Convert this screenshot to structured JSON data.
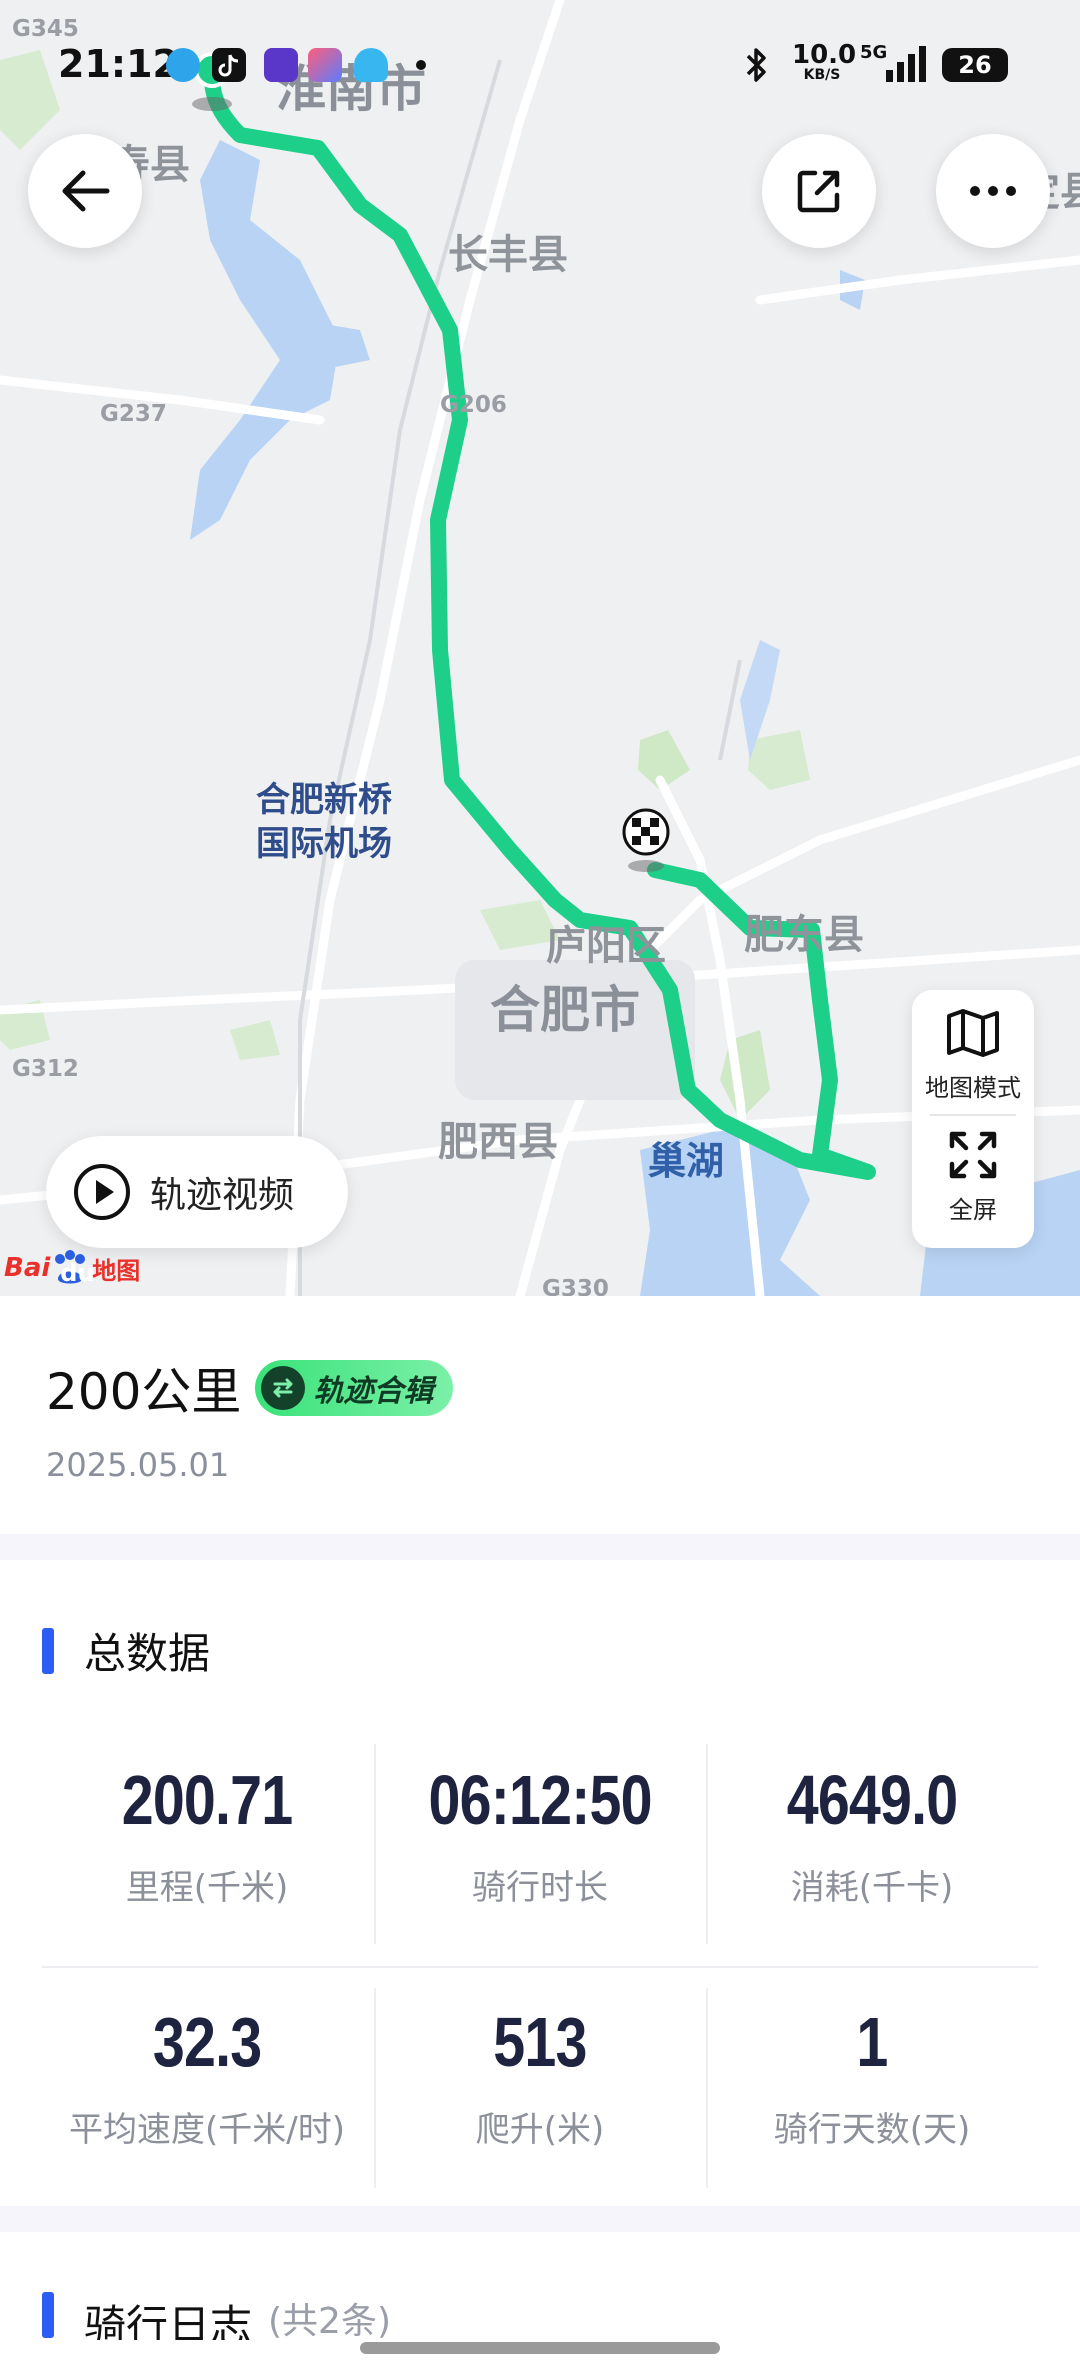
{
  "status_bar": {
    "time": "21:12",
    "net_speed_value": "10.0",
    "net_speed_unit": "KB/S",
    "network": "5G",
    "battery": "26"
  },
  "map": {
    "labels": {
      "huainan": "淮南市",
      "shou_county": "寿县",
      "changfeng": "长丰县",
      "airport_line1": "合肥新桥",
      "airport_line2": "国际机场",
      "luyang": "庐阳区",
      "hefei": "合肥市",
      "feidong": "肥东县",
      "feixi": "肥西县",
      "chaohu": "巢湖",
      "ding_county": "定县",
      "g345": "G345",
      "g237": "G237",
      "g206": "G206",
      "g312": "G312",
      "g330": "G330"
    },
    "track_video_label": "轨迹视频",
    "map_mode_label": "地图模式",
    "fullscreen_label": "全屏",
    "logo_text_1": "Bai",
    "logo_text_2": "du",
    "logo_text_3": "地图"
  },
  "activity": {
    "title": "200公里",
    "badge": "轨迹合辑",
    "date": "2025.05.01"
  },
  "summary": {
    "heading": "总数据",
    "stats": [
      {
        "value": "200.71",
        "label": "里程(千米)"
      },
      {
        "value": "06:12:50",
        "label": "骑行时长"
      },
      {
        "value": "4649.0",
        "label": "消耗(千卡)"
      },
      {
        "value": "32.3",
        "label": "平均速度(千米/时)"
      },
      {
        "value": "513",
        "label": "爬升(米)"
      },
      {
        "value": "1",
        "label": "骑行天数(天)"
      }
    ]
  },
  "log": {
    "heading": "骑行日志",
    "count": "(共2条)"
  },
  "colors": {
    "track": "#1ecf8a",
    "accent": "#2d5cf2",
    "water": "#b9d3f5",
    "green_area": "#cfe8c6"
  }
}
